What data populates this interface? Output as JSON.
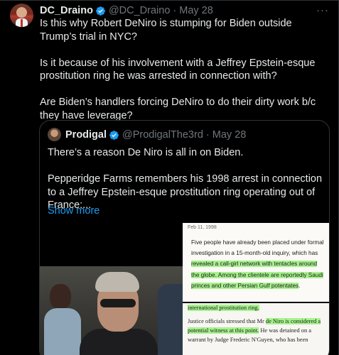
{
  "tweet": {
    "author_name": "DC_Draino",
    "author_handle": "@DC_Draino",
    "separator": "·",
    "date": "May 28",
    "more_icon": "more-horizontal-icon",
    "paragraphs": [
      "Is this why Robert DeNiro is stumping for Biden outside Trump’s trial in NYC?",
      "Is it because of his involvement with a Jeffrey Epstein-esque prostitution ring he was arrested in connection with?",
      "Are Biden’s handlers forcing DeNiro to do their dirty work b/c they have leverage?"
    ]
  },
  "quote": {
    "author_name": "Prodigal",
    "author_handle": "@ProdigalThe3rd",
    "separator": "·",
    "date": "May 28",
    "paragraphs": [
      "There’s a reason De Niro is all in on Biden.",
      "Pepperidge Farms remembers his 1998 arrest in connection to a Jeffrey Epstein-esque prostitution ring operating out of France:..."
    ],
    "show_more": "Show more"
  },
  "media": {
    "doc1": {
      "date": "Feb 11, 1998",
      "text_1": "Five people have already been placed under formal investigation in a 15-month-old inquiry, which has ",
      "text_hl_1": "revealed a call-girl network with tentacles around the globe. Among the clientele are reportedly Saudi princes and other Persian Gulf potentates",
      "text_2": "."
    },
    "doc2": {
      "hl_top": "international prostitution ring.",
      "text_1": "Justice officials stressed that Mr ",
      "hl_1": "de Niro is considered a potential witness at this point.",
      "text_2": " He was detained on a warrant by Judge Frederic N'Guyen, who has been"
    }
  },
  "colors": {
    "background": "#000000",
    "text": "#e7e9ea",
    "muted": "#71767b",
    "link": "#1d9bf0",
    "verified": "#1d9bf0",
    "highlight": "#a7f28e"
  }
}
